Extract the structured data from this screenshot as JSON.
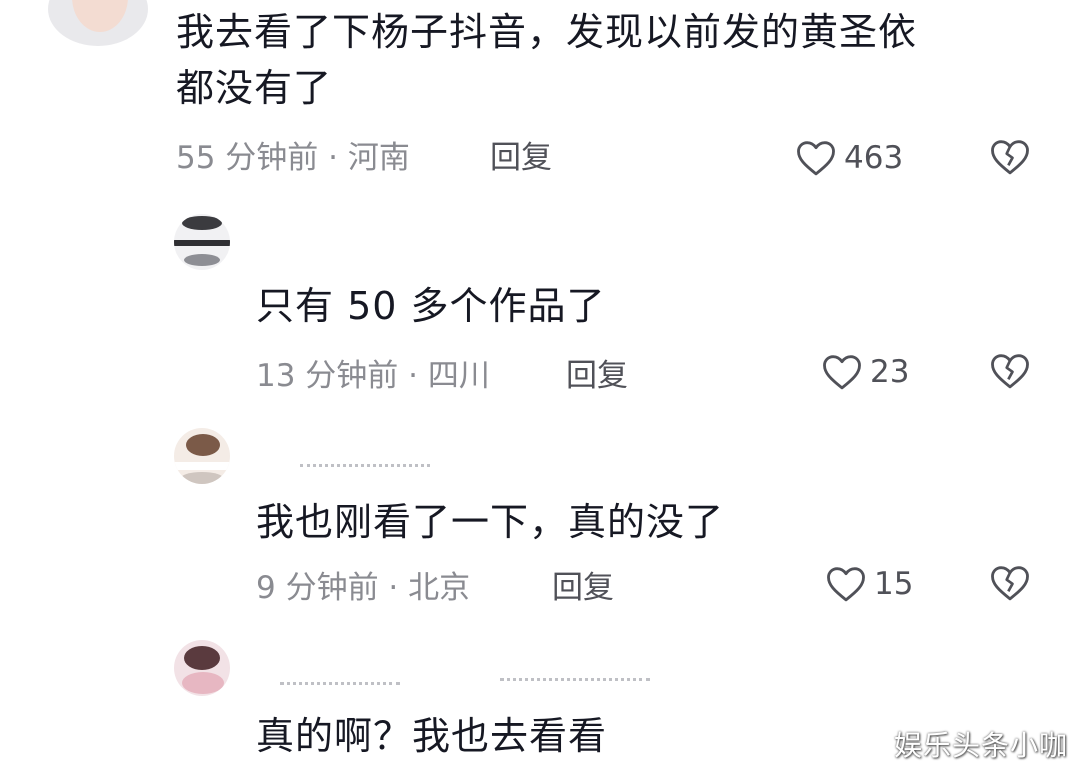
{
  "comments": [
    {
      "text": "我去看了下杨子抖音，发现以前发的黄圣依\n都没有了",
      "meta": "55 分钟前 · 河南",
      "reply": "回复",
      "likes": "463"
    },
    {
      "text": "只有 50 多个作品了",
      "meta": "13 分钟前 · 四川",
      "reply": "回复",
      "likes": "23"
    },
    {
      "text": "我也刚看了一下，真的没了",
      "meta": "9 分钟前 · 北京",
      "reply": "回复",
      "likes": "15"
    },
    {
      "text": "真的啊？我也去看看"
    }
  ],
  "watermark": "娱乐头条小咖",
  "icons": {
    "like": "heart-outline-icon",
    "dislike": "broken-heart-icon"
  },
  "colors": {
    "text": "#161823",
    "meta": "#8a8b91",
    "reply": "#505158"
  }
}
